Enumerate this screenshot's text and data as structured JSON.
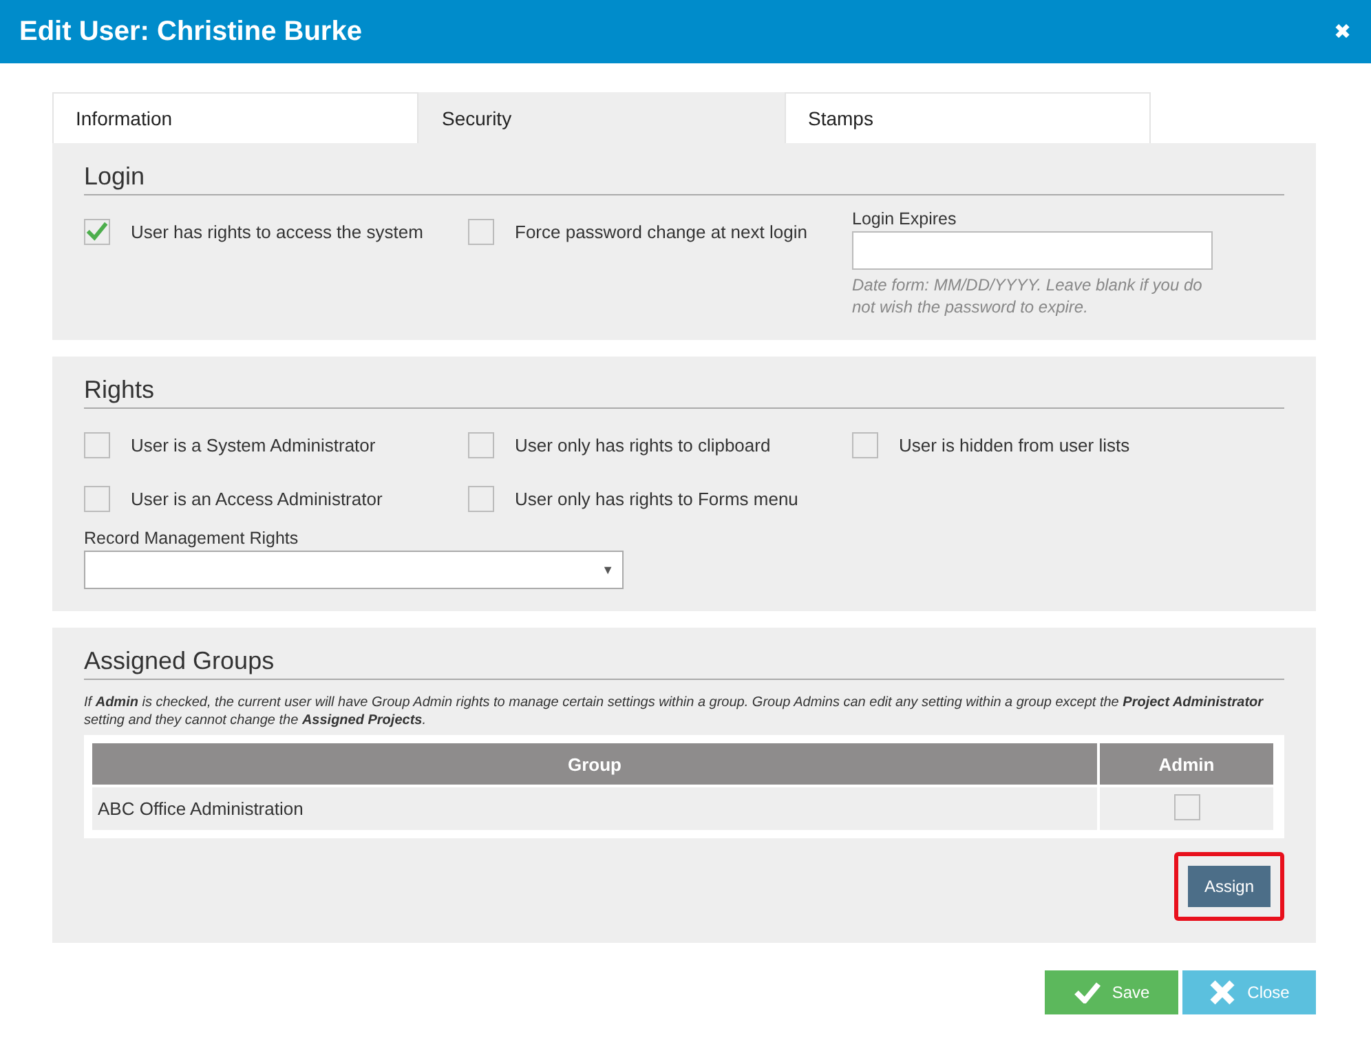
{
  "window": {
    "title": "Edit User: Christine Burke",
    "close": "✖"
  },
  "tabs": [
    {
      "label": "Information",
      "selected": false
    },
    {
      "label": "Security",
      "selected": true
    },
    {
      "label": "Stamps",
      "selected": false
    }
  ],
  "login": {
    "title": "Login",
    "options": [
      {
        "label": "User has rights to access the system",
        "checked": true
      },
      {
        "label": "Force password change at next login",
        "checked": false
      }
    ],
    "expires": {
      "label": "Login Expires",
      "help": "Date form: MM/DD/YYYY. Leave blank if you do not wish the password to expire."
    }
  },
  "rights": {
    "title": "Rights",
    "options": [
      {
        "label": "User is a System Administrator",
        "checked": false
      },
      {
        "label": "User only has rights to clipboard",
        "checked": false
      },
      {
        "label": "User is hidden from user lists",
        "checked": false
      },
      {
        "label": "User is an Access Administrator",
        "checked": false
      },
      {
        "label": "User only has rights to Forms menu",
        "checked": false
      }
    ],
    "record_management": {
      "label": "Record Management Rights",
      "caret": "▼"
    }
  },
  "groups": {
    "title": "Assigned Groups",
    "note": "If **Admin** is checked, the current user will have Group Admin rights to manage certain settings within a group. Group Admins can edit any setting within a group except the **Project Administrator** setting and they cannot change the **Assigned Projects**.",
    "columns": [
      "Group",
      "Admin"
    ],
    "rows": [
      {
        "group": "ABC Office Administration",
        "admin": false
      }
    ],
    "assign": {
      "label": "Assign",
      "highlighted": true
    }
  },
  "buttons": [
    {
      "kind": "save",
      "label": "Save"
    },
    {
      "kind": "close",
      "label": "Close"
    }
  ]
}
